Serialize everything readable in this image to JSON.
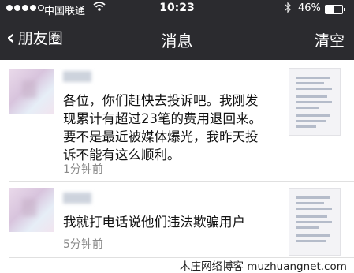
{
  "status_bar": {
    "carrier": "中国联通",
    "time": "10:23",
    "battery_percent": "46%",
    "battery_level": 0.46,
    "icons": [
      "signal-dots-icon",
      "wifi-icon",
      "bluetooth-icon",
      "battery-icon"
    ]
  },
  "nav": {
    "back_label": "朋友圈",
    "title": "消息",
    "clear_label": "清空"
  },
  "messages": [
    {
      "text": "各位，你们赶快去投诉吧。我刚发现累计有超过23笔的费用退回来。要不是最近被媒体爆光，我昨天投诉不能有这么顺利。",
      "time_ago": "1分钟前"
    },
    {
      "text": "我就打电话说他们违法欺骗用户",
      "time_ago": "5分钟前"
    }
  ],
  "watermark": "木庄网络博客 muzhuangnet.com",
  "colors": {
    "nav_background": "#2b2b2f",
    "timestamp": "#8a8a8a"
  }
}
